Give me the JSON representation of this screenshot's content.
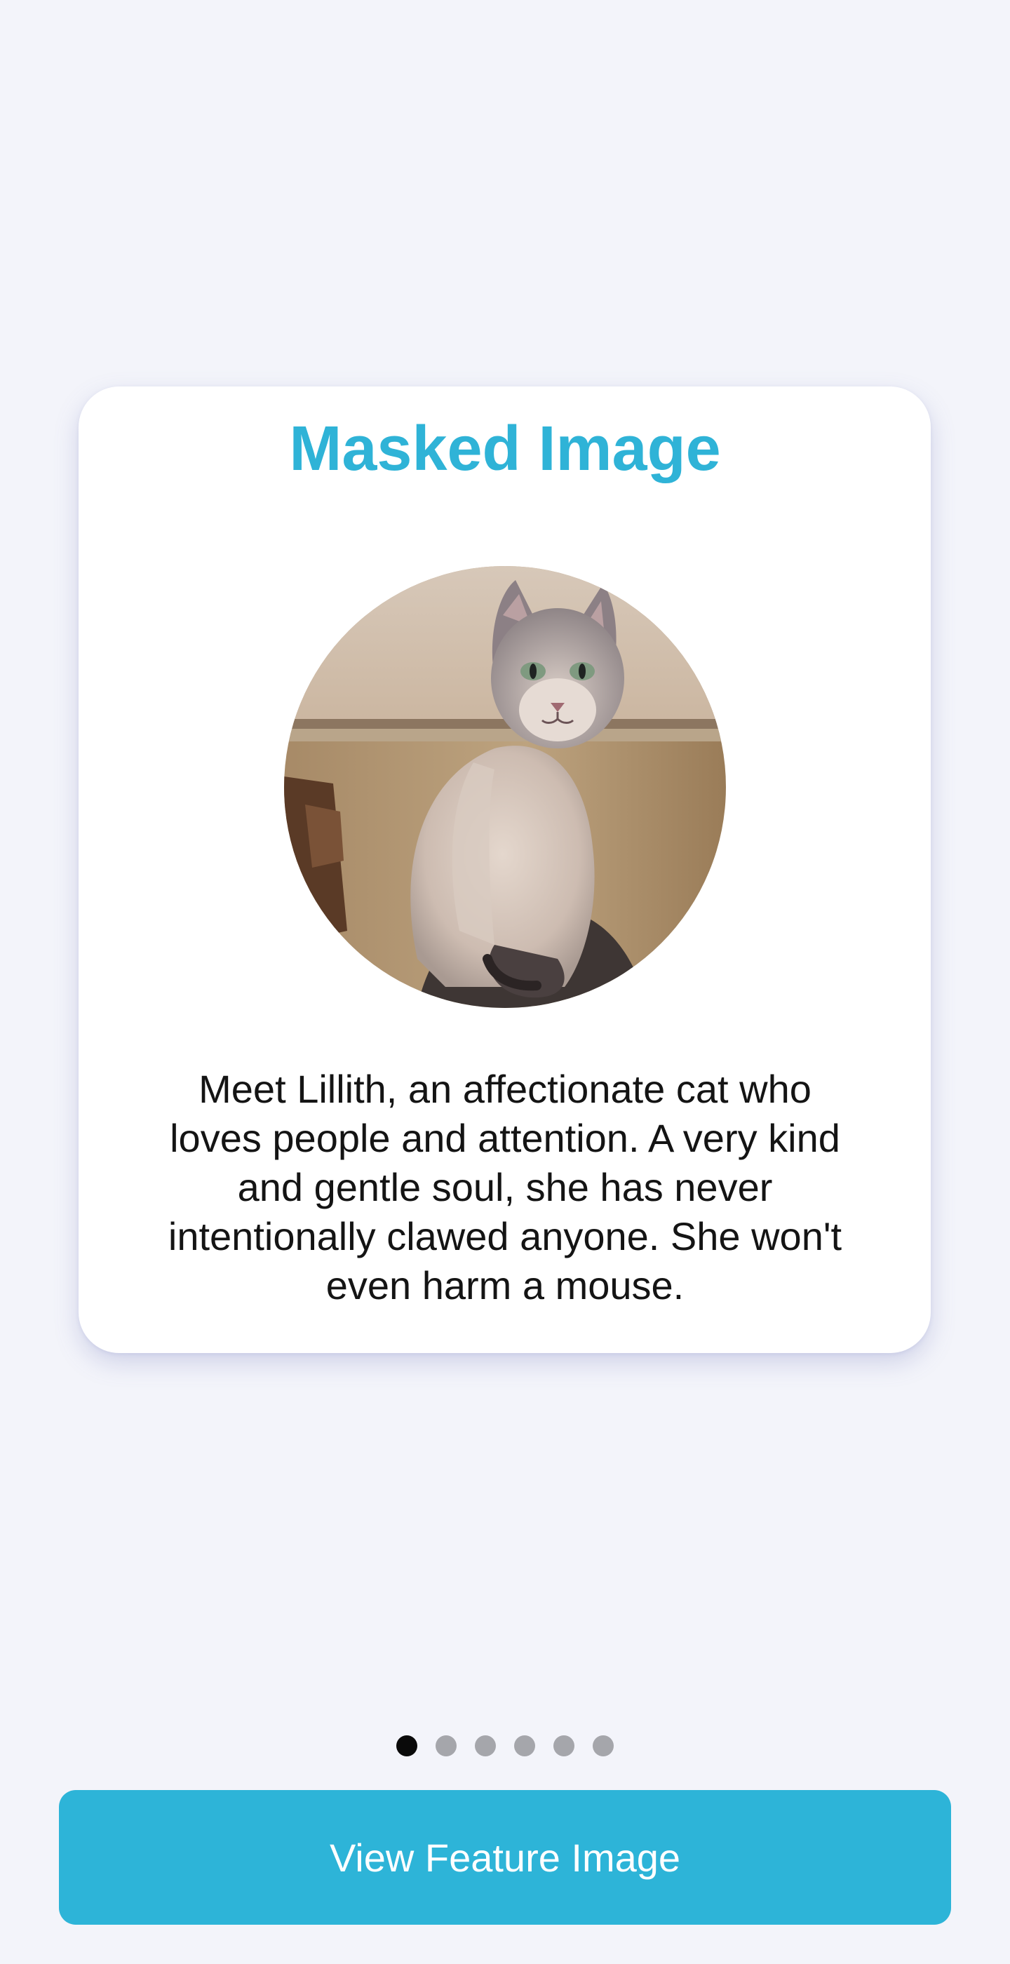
{
  "card": {
    "title": "Masked Image",
    "image_label": "cat-photo",
    "description": "Meet Lillith, an affectionate cat who\nloves people and attention.  A very kind\nand gentle soul, she has never\nintentionally clawed anyone.  She won't\neven harm a mouse."
  },
  "pager": {
    "total": 6,
    "active_index": 0
  },
  "cta": {
    "label": "View Feature Image"
  },
  "colors": {
    "accent": "#2fb3d7",
    "button": "#2db4d8",
    "background": "#f3f4fa",
    "dot_active": "#0a0a0a",
    "dot_inactive": "#a5a6ab"
  }
}
